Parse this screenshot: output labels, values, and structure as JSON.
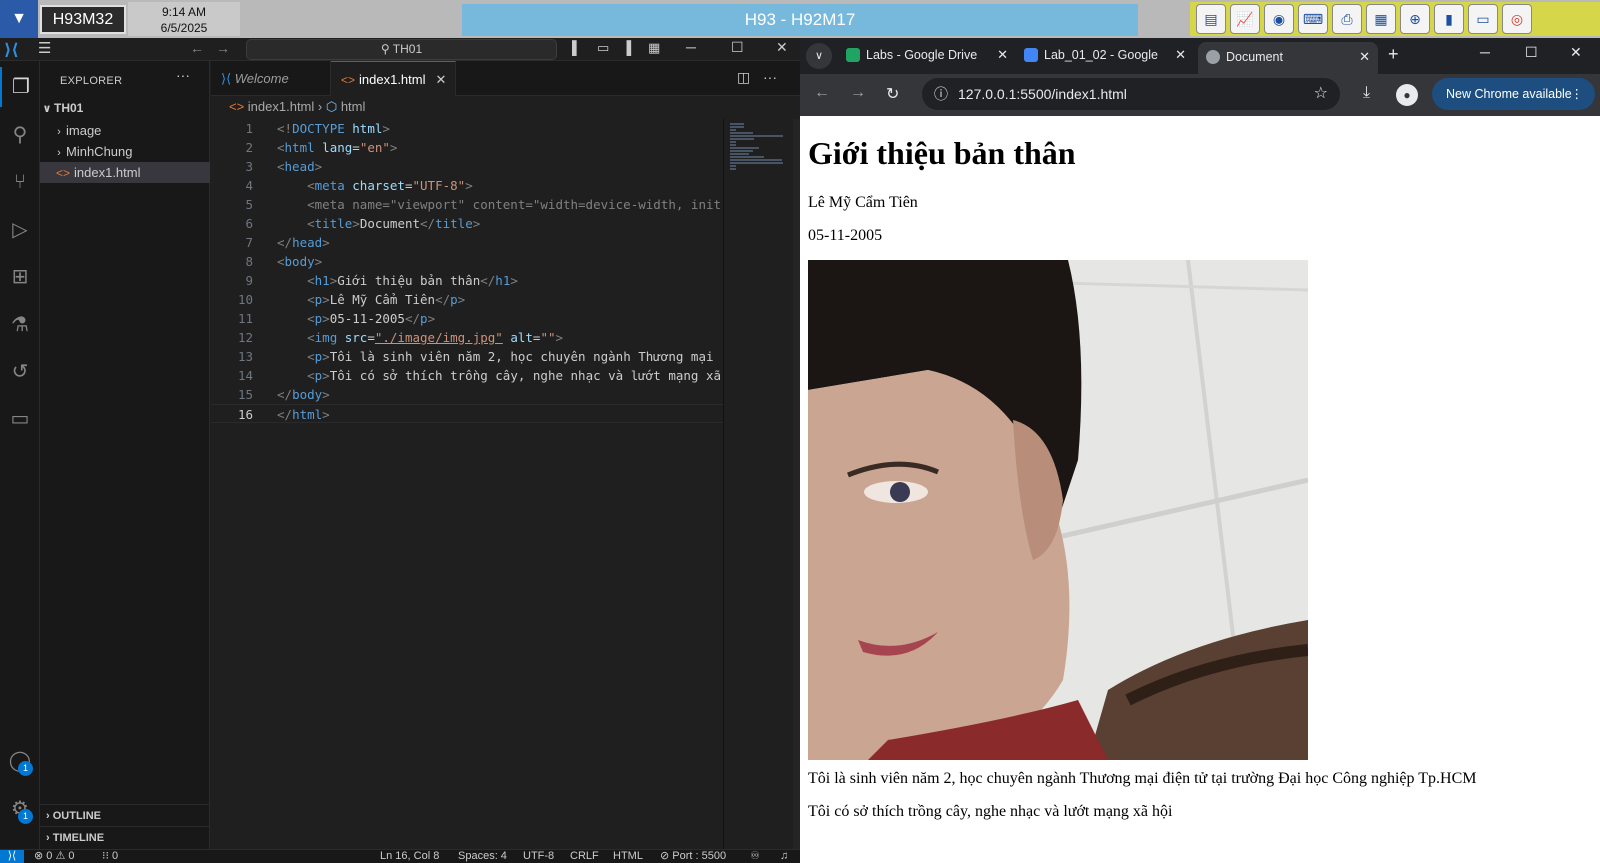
{
  "remote_bar": {
    "machine_id": "H93M32",
    "time": "9:14 AM",
    "date": "6/5/2025",
    "session_title": "H93 - H92M17",
    "tool_icons": [
      "clipboard-icon",
      "chart-icon",
      "disc-icon",
      "keyboard-icon",
      "printer-icon",
      "window-icon",
      "globe-icon",
      "book-icon",
      "chat-icon",
      "lifebuoy-icon"
    ]
  },
  "vscode": {
    "search_text": "TH01",
    "explorer": {
      "header": "EXPLORER",
      "root": "TH01",
      "items": [
        {
          "label": "image",
          "type": "folder"
        },
        {
          "label": "MinhChung",
          "type": "folder"
        },
        {
          "label": "index1.html",
          "type": "file",
          "selected": true
        }
      ],
      "outline": "OUTLINE",
      "timeline": "TIMELINE"
    },
    "tabs": [
      {
        "label": "Welcome",
        "active": false
      },
      {
        "label": "index1.html",
        "active": true
      }
    ],
    "breadcrumb": {
      "file": "index1.html",
      "symbol": "html"
    },
    "accounts_badge": "1",
    "settings_badge": "1",
    "code_lines": [
      "<!DOCTYPE html>",
      "<html lang=\"en\">",
      "<head>",
      "    <meta charset=\"UTF-8\">",
      "    <meta name=\"viewport\" content=\"width=device-width, init",
      "    <title>Document</title>",
      "</head>",
      "<body>",
      "    <h1>Giới thiệu bản thân</h1>",
      "    <p>Lê Mỹ Cẩm Tiên</p>",
      "    <p>05-11-2005</p>",
      "    <img src=\"./image/img.jpg\" alt=\"\">",
      "    <p>Tôi là sinh viên năm 2, học chuyên ngành Thương mại",
      "    <p>Tôi có sở thích trồng cây, nghe nhạc và lướt mạng xã",
      "</body>",
      "</html>"
    ],
    "current_line": 16,
    "status": {
      "problems": "⊗ 0 ⚠ 0",
      "ports_text": "⁝⁝ 0",
      "position": "Ln 16, Col 8",
      "spaces": "Spaces: 4",
      "encoding": "UTF-8",
      "eol": "CRLF",
      "language": "HTML",
      "port": "Port : 5500"
    }
  },
  "chrome": {
    "tabs": [
      {
        "label": "Labs - Google Drive",
        "favicon_color": "#1fa463"
      },
      {
        "label": "Lab_01_02 - Google",
        "favicon_color": "#4285f4"
      },
      {
        "label": "Document",
        "favicon_color": "#9aa0a6",
        "active": true
      }
    ],
    "url": "127.0.0.1:5500/index1.html",
    "update_label": "New Chrome available",
    "page": {
      "heading": "Giới thiệu bản thân",
      "name": "Lê Mỹ Cẩm Tiên",
      "dob": "05-11-2005",
      "intro": "Tôi là sinh viên năm 2, học chuyên ngành Thương mại điện tử tại trường Đại học Công nghiệp Tp.HCM",
      "hobbies": "Tôi có sở thích trồng cây, nghe nhạc và lướt mạng xã hội"
    }
  },
  "colors": {
    "vscode_accent": "#0078d4",
    "chrome_update": "#1d4e7f",
    "session_bar": "#76b9dc"
  }
}
